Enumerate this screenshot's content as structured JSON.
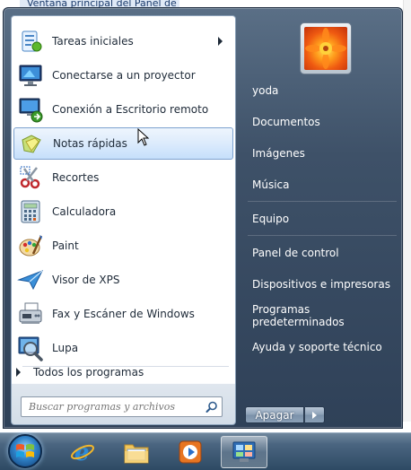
{
  "background": {
    "window_title": "Ventana principal del Panel de"
  },
  "start_menu": {
    "programs": [
      {
        "label": "Tareas iniciales",
        "icon": "getting-started-icon",
        "submenu": true
      },
      {
        "label": "Conectarse a un proyector",
        "icon": "projector-icon"
      },
      {
        "label": "Conexión a Escritorio remoto",
        "icon": "remote-desktop-icon"
      },
      {
        "label": "Notas rápidas",
        "icon": "sticky-notes-icon",
        "highlighted": true
      },
      {
        "label": "Recortes",
        "icon": "snipping-tool-icon"
      },
      {
        "label": "Calculadora",
        "icon": "calculator-icon"
      },
      {
        "label": "Paint",
        "icon": "paint-icon"
      },
      {
        "label": "Visor de XPS",
        "icon": "xps-viewer-icon"
      },
      {
        "label": "Fax y Escáner de Windows",
        "icon": "fax-scanner-icon"
      },
      {
        "label": "Lupa",
        "icon": "magnifier-icon"
      }
    ],
    "all_programs": "Todos los programas",
    "search": {
      "placeholder": "Buscar programas y archivos",
      "value": ""
    },
    "right_items": [
      {
        "label": "yoda"
      },
      {
        "label": "Documentos"
      },
      {
        "label": "Imágenes"
      },
      {
        "label": "Música"
      },
      {
        "label": "Equipo"
      },
      {
        "label": "Panel de control"
      },
      {
        "label": "Dispositivos e impresoras"
      },
      {
        "label": "Programas predeterminados"
      },
      {
        "label": "Ayuda y soporte técnico"
      }
    ],
    "shutdown_label": "Apagar"
  },
  "taskbar": {
    "items": [
      "internet-explorer-icon",
      "windows-explorer-icon",
      "media-player-icon",
      "control-panel-icon"
    ],
    "active_item": "control-panel-icon"
  }
}
